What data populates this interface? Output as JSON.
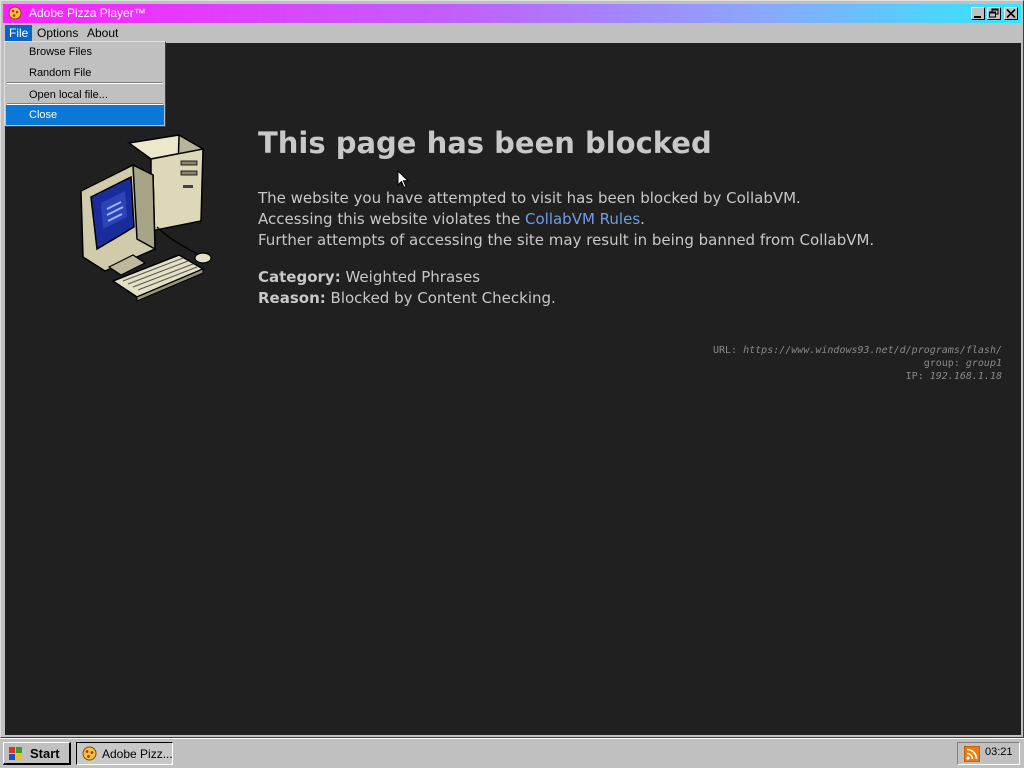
{
  "window": {
    "title": "Adobe Pizza Player™",
    "icon": "pizza-icon"
  },
  "menubar": {
    "items": [
      {
        "label": "File"
      },
      {
        "label": "Options"
      },
      {
        "label": "About"
      }
    ]
  },
  "file_menu": {
    "items": [
      {
        "label": "Browse Files"
      },
      {
        "label": "Random File"
      },
      {
        "label": "Open local file..."
      },
      {
        "label": "Close"
      }
    ],
    "highlighted": "Close"
  },
  "blocked_page": {
    "heading": "This page has been blocked",
    "line1": "The website you have attempted to visit has been blocked by CollabVM.",
    "line2_prefix": "Accessing this website violates the ",
    "line2_link": "CollabVM Rules",
    "line2_suffix": ".",
    "line3": "Further attempts of accessing the site may result in being banned from CollabVM.",
    "category_label": "Category:",
    "category_value": " Weighted Phrases",
    "reason_label": "Reason:",
    "reason_value": " Blocked by Content Checking.",
    "url_label": "URL: ",
    "url_value": "https://www.windows93.net/d/programs/flash/",
    "group_label": "group: ",
    "group_value": "group1",
    "ip_label": "IP: ",
    "ip_value": "192.168.1.18",
    "link_color": "#6f9de6",
    "background": "#202020"
  },
  "taskbar": {
    "start_label": "Start",
    "task_label": "Adobe Pizz...",
    "clock": "03:21",
    "tray_icon": "rss-icon"
  }
}
